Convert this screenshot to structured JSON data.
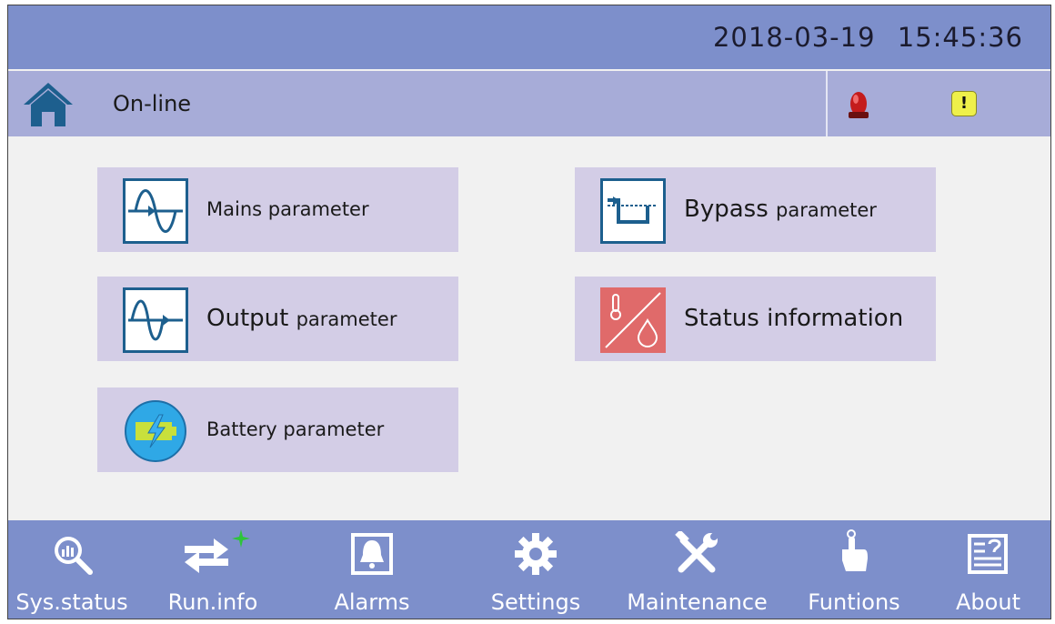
{
  "header": {
    "date": "2018-03-19",
    "time": "15:45:36"
  },
  "status": {
    "mode": "On-line",
    "icons": [
      "home-icon",
      "alarm-siren-icon",
      "warning-icon"
    ],
    "warning_glyph": "!"
  },
  "tiles": [
    {
      "id": "mains",
      "label": "Mains parameter",
      "icon": "mains-waveform-icon"
    },
    {
      "id": "bypass",
      "label_main": "Bypass",
      "label_sub": "parameter",
      "icon": "bypass-icon"
    },
    {
      "id": "output",
      "label_main": "Output",
      "label_sub": "parameter",
      "icon": "output-waveform-icon"
    },
    {
      "id": "status",
      "label": "Status information",
      "icon": "temperature-humidity-icon"
    },
    {
      "id": "battery",
      "label": "Battery parameter",
      "icon": "battery-charge-icon"
    }
  ],
  "nav": [
    {
      "label": "Sys.status",
      "icon": "magnifier-chart-icon"
    },
    {
      "label": "Run.info",
      "icon": "swap-arrows-icon"
    },
    {
      "label": "Alarms",
      "icon": "bell-icon"
    },
    {
      "label": "Settings",
      "icon": "gear-icon"
    },
    {
      "label": "Maintenance",
      "icon": "tools-icon"
    },
    {
      "label": "Funtions",
      "icon": "pointing-hand-icon"
    },
    {
      "label": "About",
      "icon": "help-document-icon"
    }
  ],
  "colors": {
    "topbar": "#7d8fcb",
    "statusbar": "#a7acd8",
    "tile": "#d3cde6",
    "icon_blue": "#1d5f8e",
    "status_tile_icon": "#e06a6a",
    "warning": "#eef04a"
  }
}
